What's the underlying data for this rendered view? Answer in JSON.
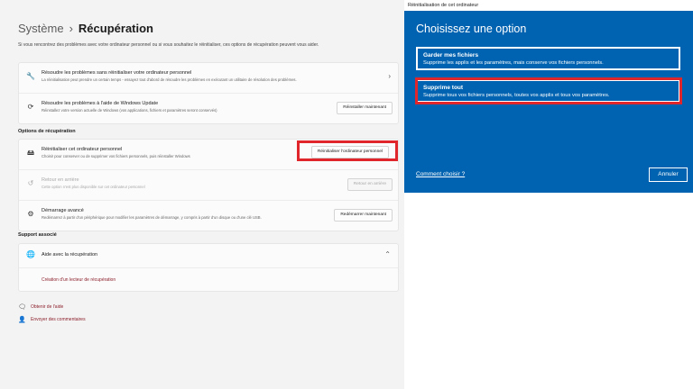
{
  "settings": {
    "breadcrumb_parent": "Système",
    "breadcrumb_sep": "›",
    "breadcrumb_current": "Récupération",
    "description": "Si vous rencontrez des problèmes avec votre ordinateur personnel ou si vous souhaitez le réinitialiser, ces options de récupération peuvent vous aider.",
    "troubleshoot": {
      "title": "Résoudre les problèmes sans réinitialiser votre ordinateur personnel",
      "subtitle": "La réinitialisation peut prendre un certain temps - essayez tout d'abord de résoudre les problèmes en exécutant un utilitaire de résolution des problèmes.",
      "chevron": "›"
    },
    "windows_update": {
      "title": "Résoudre les problèmes à l'aide de Windows Update",
      "subtitle": "Réinstallez votre version actuelle de Windows (vos applications, fichiers et paramètres seront conservés)",
      "button": "Réinstaller maintenant"
    },
    "section_recovery": "Options de récupération",
    "reset": {
      "title": "Réinitialiser cet ordinateur personnel",
      "subtitle": "Choisir pour conserver ou de supprimer vos fichiers personnels, puis réinstaller Windows",
      "button": "Réinitialiser l'ordinateur personnel"
    },
    "go_back": {
      "title": "Retour en arrière",
      "subtitle": "Cette option n'est plus disponible sur cet ordinateur personnel",
      "button": "Retour en arrière"
    },
    "advanced": {
      "title": "Démarrage avancé",
      "subtitle": "Redémarrez à partir d'un périphérique pour modifier les paramètres de démarrage, y compris à partir d'un disque ou d'une clé USB.",
      "button": "Redémarrer maintenant"
    },
    "section_support": "Support associé",
    "help": {
      "title": "Aide avec la récupération",
      "chevron": "⌃",
      "link": "Création d'un lecteur de récupération"
    },
    "footer": {
      "get_help": "Obtenir de l'aide",
      "feedback": "Envoyer des commentaires"
    }
  },
  "dialog": {
    "bar_title": "Réinitialisation de cet ordinateur",
    "heading": "Choisissez une option",
    "option_keep": {
      "title": "Garder mes fichiers",
      "subtitle": "Supprime les applis et les paramètres, mais conserve vos fichiers personnels."
    },
    "option_remove": {
      "title": "Supprime tout",
      "subtitle": "Supprime tous vos fichiers personnels, toutes vos applis et tous vos paramètres."
    },
    "help_link": "Comment choisir ?",
    "cancel": "Annuler"
  },
  "colors": {
    "dialog_bg": "#0063b1",
    "highlight": "#e0262b",
    "link": "#8b1e2a"
  }
}
